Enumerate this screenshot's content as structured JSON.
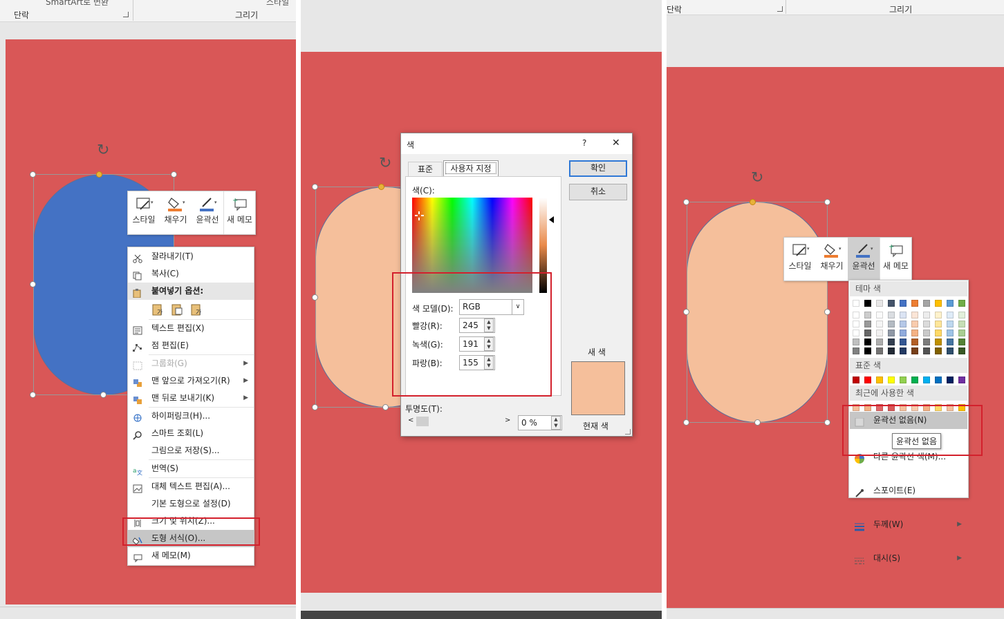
{
  "panel1": {
    "ribbon": {
      "group_para": "단락",
      "group_draw": "그리기",
      "smartart": "SmartArt로 변환",
      "style_cut": "스타일"
    },
    "mini_toolbar": {
      "style": "스타일",
      "fill": "채우기",
      "outline": "윤곽선",
      "new_memo": "새 메모"
    },
    "context_menu": {
      "cut": "잘라내기(T)",
      "copy": "복사(C)",
      "paste_options": "붙여넣기 옵션:",
      "edit_text": "텍스트 편집(X)",
      "edit_points": "점 편집(E)",
      "group": "그룹화(G)",
      "bring_front": "맨 앞으로 가져오기(R)",
      "send_back": "맨 뒤로 보내기(K)",
      "hyperlink": "하이퍼링크(H)...",
      "smart_lookup": "스마트 조회(L)",
      "save_as_picture": "그림으로 저장(S)...",
      "translate": "번역(S)",
      "alt_text": "대체 텍스트 편집(A)...",
      "set_default": "기본 도형으로 설정(D)",
      "size_position": "크기 및 위치(Z)...",
      "format_shape": "도형 서식(O)...",
      "new_memo": "새 메모(M)"
    },
    "shape_color": "#4472c4"
  },
  "panel2": {
    "dialog": {
      "title": "색",
      "help": "?",
      "close": "✕",
      "tab_standard": "표준",
      "tab_custom": "사용자 지정",
      "colors_label": "색(C):",
      "color_model_label": "색 모델(D):",
      "color_model_value": "RGB",
      "red_label": "빨강(R):",
      "red_value": "245",
      "green_label": "녹색(G):",
      "green_value": "191",
      "blue_label": "파랑(B):",
      "blue_value": "155",
      "transparency_label": "투명도(T):",
      "transparency_value": "0 %",
      "ok": "확인",
      "cancel": "취소",
      "new_color": "새 색",
      "current_color": "현재 색"
    },
    "shape_color": "#f5bf9b"
  },
  "panel3": {
    "ribbon": {
      "group_para": "단락",
      "group_draw": "그리기"
    },
    "mini_toolbar": {
      "style": "스타일",
      "fill": "채우기",
      "outline": "윤곽선",
      "new_memo": "새 메모"
    },
    "outline_menu": {
      "theme_colors": "테마 색",
      "standard_colors": "표준 색",
      "recent_colors": "최근에 사용한 색",
      "no_outline": "윤곽선 없음(N)",
      "more_colors": "다른 윤곽선 색(M)...",
      "eyedropper": "스포이트(E)",
      "weight": "두께(W)",
      "dashes": "대시(S)",
      "tooltip": "윤곽선 없음"
    },
    "shape_color": "#f5bf9b"
  },
  "colors": {
    "slide_bg": "#d95757",
    "highlight_box": "#d3202c",
    "theme_top": [
      "#ffffff",
      "#000000",
      "#e7e6e6",
      "#44546a",
      "#4472c4",
      "#ed7d31",
      "#a5a5a5",
      "#ffc000",
      "#5b9bd5",
      "#70ad47"
    ],
    "standard": [
      "#c00000",
      "#ff0000",
      "#ffc000",
      "#ffff00",
      "#92d050",
      "#00b050",
      "#00b0f0",
      "#0070c0",
      "#002060",
      "#7030a0"
    ],
    "recent": [
      "#f5bf9b",
      "#f4b183",
      "#e06666",
      "#d95757",
      "#f5bf9b",
      "#f8cbad",
      "#f4b183",
      "#ffd966",
      "#f5bf9b",
      "#ffc000"
    ]
  }
}
